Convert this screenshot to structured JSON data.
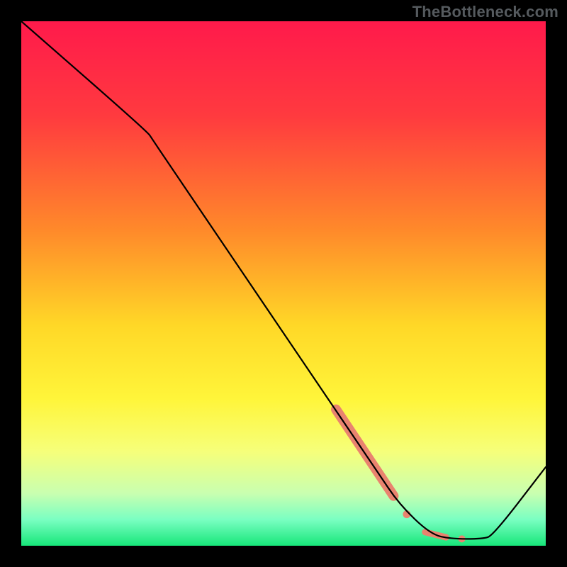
{
  "watermark": "TheBottleneck.com",
  "chart_data": {
    "type": "line",
    "xlim": [
      0,
      100
    ],
    "ylim": [
      0,
      100
    ],
    "title": "",
    "xlabel": "",
    "ylabel": "",
    "gradient_stops": [
      {
        "offset": 0,
        "color": "#ff1a4b"
      },
      {
        "offset": 18,
        "color": "#ff3a3f"
      },
      {
        "offset": 40,
        "color": "#ff8a2a"
      },
      {
        "offset": 58,
        "color": "#ffd827"
      },
      {
        "offset": 72,
        "color": "#fff53a"
      },
      {
        "offset": 82,
        "color": "#f6ff7a"
      },
      {
        "offset": 90,
        "color": "#c9ffb0"
      },
      {
        "offset": 95,
        "color": "#7affc2"
      },
      {
        "offset": 100,
        "color": "#17e67a"
      }
    ],
    "series": [
      {
        "name": "bottleneck-curve",
        "color": "#000000",
        "points": [
          {
            "x": 0,
            "y": 100
          },
          {
            "x": 24,
            "y": 79
          },
          {
            "x": 25,
            "y": 77.5
          },
          {
            "x": 28,
            "y": 73
          },
          {
            "x": 68,
            "y": 14
          },
          {
            "x": 72,
            "y": 8
          },
          {
            "x": 78,
            "y": 2.2
          },
          {
            "x": 82,
            "y": 1.3
          },
          {
            "x": 88,
            "y": 1.3
          },
          {
            "x": 90,
            "y": 2
          },
          {
            "x": 100,
            "y": 15
          }
        ]
      }
    ],
    "highlight_segments": [
      {
        "name": "highlight-thick",
        "color": "#e9836f",
        "width": 14,
        "x1": 60,
        "y1": 26,
        "x2": 71,
        "y2": 9.5
      },
      {
        "name": "highlight-dot-1",
        "color": "#e9836f",
        "r": 5.5,
        "cx": 73.5,
        "cy": 6
      },
      {
        "name": "highlight-dash",
        "color": "#e9836f",
        "width": 9,
        "x1": 77,
        "y1": 2.6,
        "x2": 81,
        "y2": 1.6
      },
      {
        "name": "highlight-dot-2",
        "color": "#e9836f",
        "r": 5,
        "cx": 84,
        "cy": 1.3
      }
    ]
  }
}
